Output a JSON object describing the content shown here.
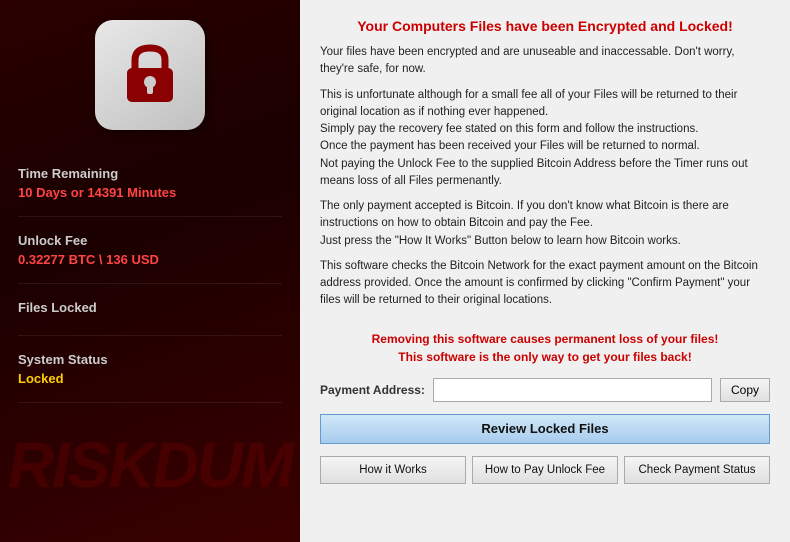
{
  "left": {
    "watermark": "RISKDUM",
    "time_label": "Time Remaining",
    "time_value": "10 Days or 14391 Minutes",
    "unlock_label": "Unlock Fee",
    "unlock_value": "0.32277 BTC \\ 136 USD",
    "files_label": "Files Locked",
    "files_value": "",
    "status_label": "System Status",
    "status_value": "Locked"
  },
  "right": {
    "title": "Your Computers Files have been Encrypted and Locked!",
    "para1": "Your files have been encrypted and are unuseable and inaccessable. Don't worry, they're safe, for now.",
    "para2": "This is unfortunate although for a small fee all of your Files will be returned to their original location as if nothing ever happened.\nSimply pay the recovery fee stated on this form and follow the instructions.\nOnce the payment has been received your Files will be returned to normal.\nNot paying the Unlock Fee to the supplied Bitcoin Address before the Timer runs out means loss of all Files permenantly.",
    "para3": "The only payment accepted is Bitcoin. If you don't know what Bitcoin is there are instructions on how to obtain Bitcoin and pay the Fee.\nJust press the \"How It Works\" Button below to learn how Bitcoin works.",
    "para4": "This software checks the Bitcoin Network for the exact payment amount on the Bitcoin address provided. Once the amount is confirmed by clicking \"Confirm Payment\" your files will be returned to their original locations.",
    "warning1": "Removing this software causes permanent loss of your files!",
    "warning2": "This software is the only way to get your files back!",
    "payment_label": "Payment Address:",
    "payment_value": "",
    "copy_btn": "Copy",
    "review_btn": "Review Locked Files",
    "how_works_btn": "How it Works",
    "how_pay_btn": "How to Pay Unlock Fee",
    "check_payment_btn": "Check Payment Status"
  }
}
